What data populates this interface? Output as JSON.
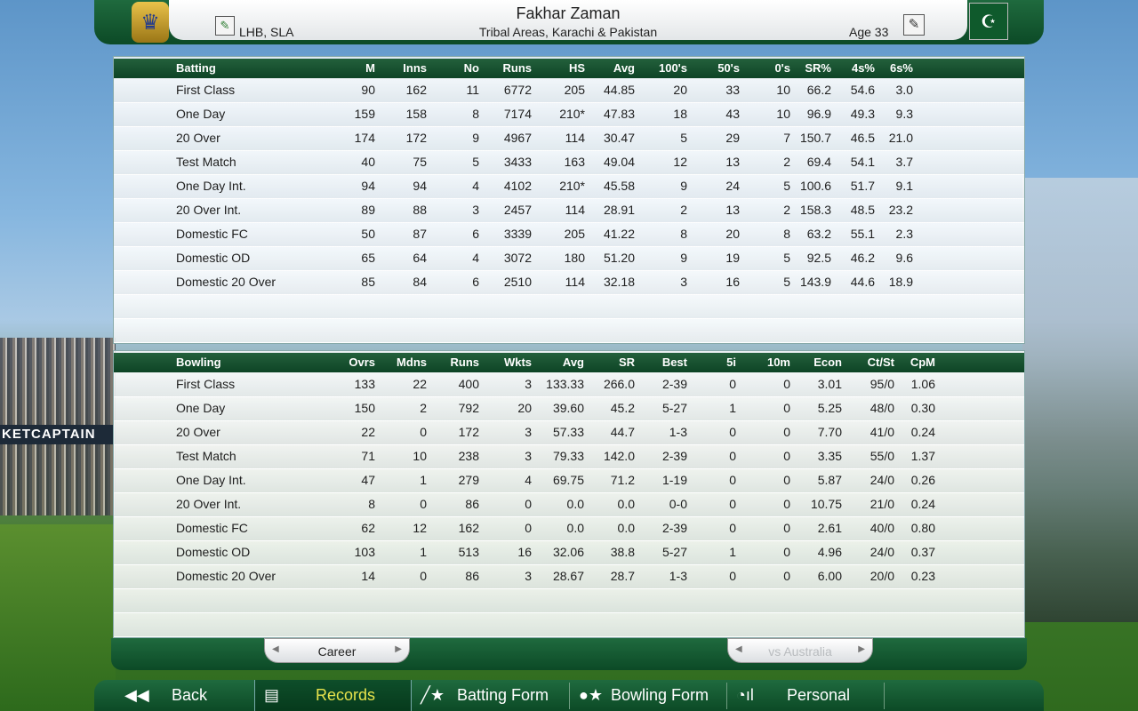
{
  "header": {
    "player_name": "Fakhar Zaman",
    "bat_info": "LHB, SLA",
    "region": "Tribal Areas, Karachi & Pakistan",
    "age": "Age 33",
    "crest_icon": "crown-icon",
    "flag_icon": "pakistan-flag-icon"
  },
  "batting": {
    "headers": [
      "Batting",
      "M",
      "Inns",
      "No",
      "Runs",
      "HS",
      "Avg",
      "100's",
      "50's",
      "0's",
      "SR%",
      "4s%",
      "6s%"
    ],
    "rows": [
      [
        "First Class",
        "90",
        "162",
        "11",
        "6772",
        "205",
        "44.85",
        "20",
        "33",
        "10",
        "66.2",
        "54.6",
        "3.0"
      ],
      [
        "One Day",
        "159",
        "158",
        "8",
        "7174",
        "210*",
        "47.83",
        "18",
        "43",
        "10",
        "96.9",
        "49.3",
        "9.3"
      ],
      [
        "20 Over",
        "174",
        "172",
        "9",
        "4967",
        "114",
        "30.47",
        "5",
        "29",
        "7",
        "150.7",
        "46.5",
        "21.0"
      ],
      [
        "Test Match",
        "40",
        "75",
        "5",
        "3433",
        "163",
        "49.04",
        "12",
        "13",
        "2",
        "69.4",
        "54.1",
        "3.7"
      ],
      [
        "One Day Int.",
        "94",
        "94",
        "4",
        "4102",
        "210*",
        "45.58",
        "9",
        "24",
        "5",
        "100.6",
        "51.7",
        "9.1"
      ],
      [
        "20 Over Int.",
        "89",
        "88",
        "3",
        "2457",
        "114",
        "28.91",
        "2",
        "13",
        "2",
        "158.3",
        "48.5",
        "23.2"
      ],
      [
        "Domestic FC",
        "50",
        "87",
        "6",
        "3339",
        "205",
        "41.22",
        "8",
        "20",
        "8",
        "63.2",
        "55.1",
        "2.3"
      ],
      [
        "Domestic OD",
        "65",
        "64",
        "4",
        "3072",
        "180",
        "51.20",
        "9",
        "19",
        "5",
        "92.5",
        "46.2",
        "9.6"
      ],
      [
        "Domestic 20 Over",
        "85",
        "84",
        "6",
        "2510",
        "114",
        "32.18",
        "3",
        "16",
        "5",
        "143.9",
        "44.6",
        "18.9"
      ]
    ]
  },
  "bowling": {
    "headers": [
      "Bowling",
      "Ovrs",
      "Mdns",
      "Runs",
      "Wkts",
      "Avg",
      "SR",
      "Best",
      "5i",
      "10m",
      "Econ",
      "Ct/St",
      "CpM"
    ],
    "rows": [
      [
        "First Class",
        "133",
        "22",
        "400",
        "3",
        "133.33",
        "266.0",
        "2-39",
        "0",
        "0",
        "3.01",
        "95/0",
        "1.06"
      ],
      [
        "One Day",
        "150",
        "2",
        "792",
        "20",
        "39.60",
        "45.2",
        "5-27",
        "1",
        "0",
        "5.25",
        "48/0",
        "0.30"
      ],
      [
        "20 Over",
        "22",
        "0",
        "172",
        "3",
        "57.33",
        "44.7",
        "1-3",
        "0",
        "0",
        "7.70",
        "41/0",
        "0.24"
      ],
      [
        "Test Match",
        "71",
        "10",
        "238",
        "3",
        "79.33",
        "142.0",
        "2-39",
        "0",
        "0",
        "3.35",
        "55/0",
        "1.37"
      ],
      [
        "One Day Int.",
        "47",
        "1",
        "279",
        "4",
        "69.75",
        "71.2",
        "1-19",
        "0",
        "0",
        "5.87",
        "24/0",
        "0.26"
      ],
      [
        "20 Over Int.",
        "8",
        "0",
        "86",
        "0",
        "0.0",
        "0.0",
        "0-0",
        "0",
        "0",
        "10.75",
        "21/0",
        "0.24"
      ],
      [
        "Domestic FC",
        "62",
        "12",
        "162",
        "0",
        "0.0",
        "0.0",
        "2-39",
        "0",
        "0",
        "2.61",
        "40/0",
        "0.80"
      ],
      [
        "Domestic OD",
        "103",
        "1",
        "513",
        "16",
        "32.06",
        "38.8",
        "5-27",
        "1",
        "0",
        "4.96",
        "24/0",
        "0.37"
      ],
      [
        "Domestic 20 Over",
        "14",
        "0",
        "86",
        "3",
        "28.67",
        "28.7",
        "1-3",
        "0",
        "0",
        "6.00",
        "20/0",
        "0.23"
      ]
    ]
  },
  "selectors": {
    "career": "Career",
    "opponent": "vs Australia"
  },
  "background": {
    "board_text": "KETCAPTAIN"
  },
  "nav": {
    "back": "Back",
    "records": "Records",
    "batting_form": "Batting Form",
    "bowling_form": "Bowling Form",
    "personal": "Personal"
  },
  "colors": {
    "header_green": "#0c4a26",
    "records_highlight": "#e7e34c"
  }
}
